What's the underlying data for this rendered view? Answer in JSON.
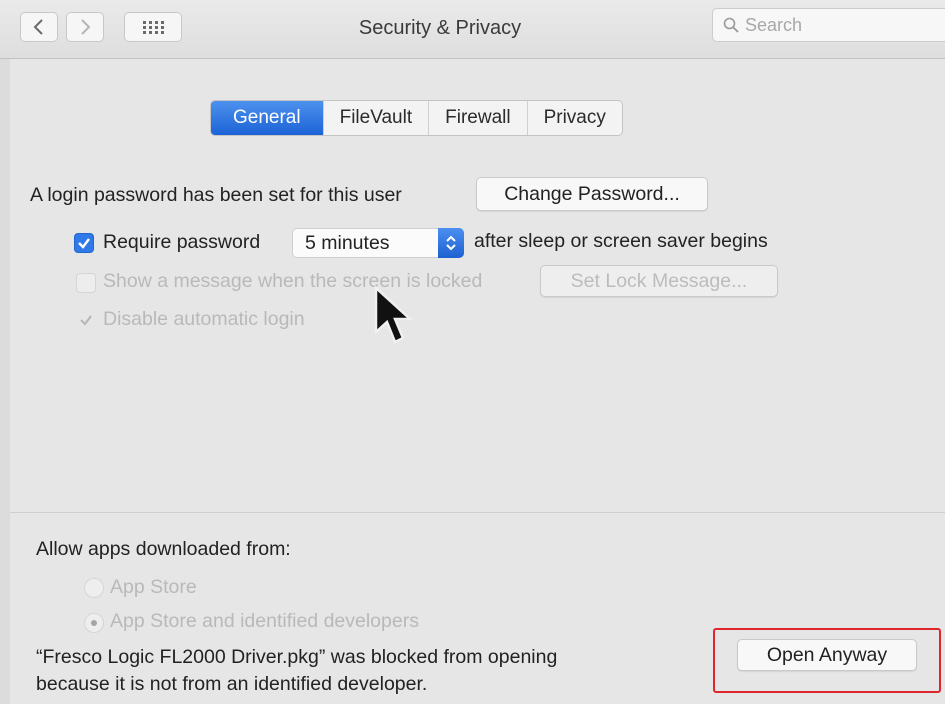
{
  "window": {
    "title": "Security & Privacy"
  },
  "toolbar": {
    "back_icon": "chevron-left-icon",
    "forward_icon": "chevron-right-icon",
    "grid_icon": "grid-icon",
    "search_placeholder": "Search"
  },
  "tabs": [
    {
      "label": "General",
      "selected": true
    },
    {
      "label": "FileVault",
      "selected": false
    },
    {
      "label": "Firewall",
      "selected": false
    },
    {
      "label": "Privacy",
      "selected": false
    }
  ],
  "general": {
    "login_password_text": "A login password has been set for this user",
    "change_password_label": "Change Password...",
    "require_password": {
      "label": "Require password",
      "checked": true
    },
    "require_interval": "5 minutes",
    "after_text": "after sleep or screen saver begins",
    "show_message": {
      "label": "Show a message when the screen is locked",
      "checked": false,
      "enabled": false
    },
    "set_lock_message_label": "Set Lock Message...",
    "disable_login": {
      "label": "Disable automatic login",
      "checked": true,
      "enabled": false
    }
  },
  "allow_apps": {
    "heading": "Allow apps downloaded from:",
    "options": [
      {
        "label": "App Store",
        "selected": false
      },
      {
        "label": "App Store and identified developers",
        "selected": true
      }
    ],
    "blocked_line1": "“Fresco Logic FL2000 Driver.pkg” was blocked from opening",
    "blocked_line2": "because it is not from an identified developer.",
    "open_anyway_label": "Open Anyway"
  },
  "colors": {
    "accent": "#2f79e8",
    "annotation": "#e0262d"
  }
}
